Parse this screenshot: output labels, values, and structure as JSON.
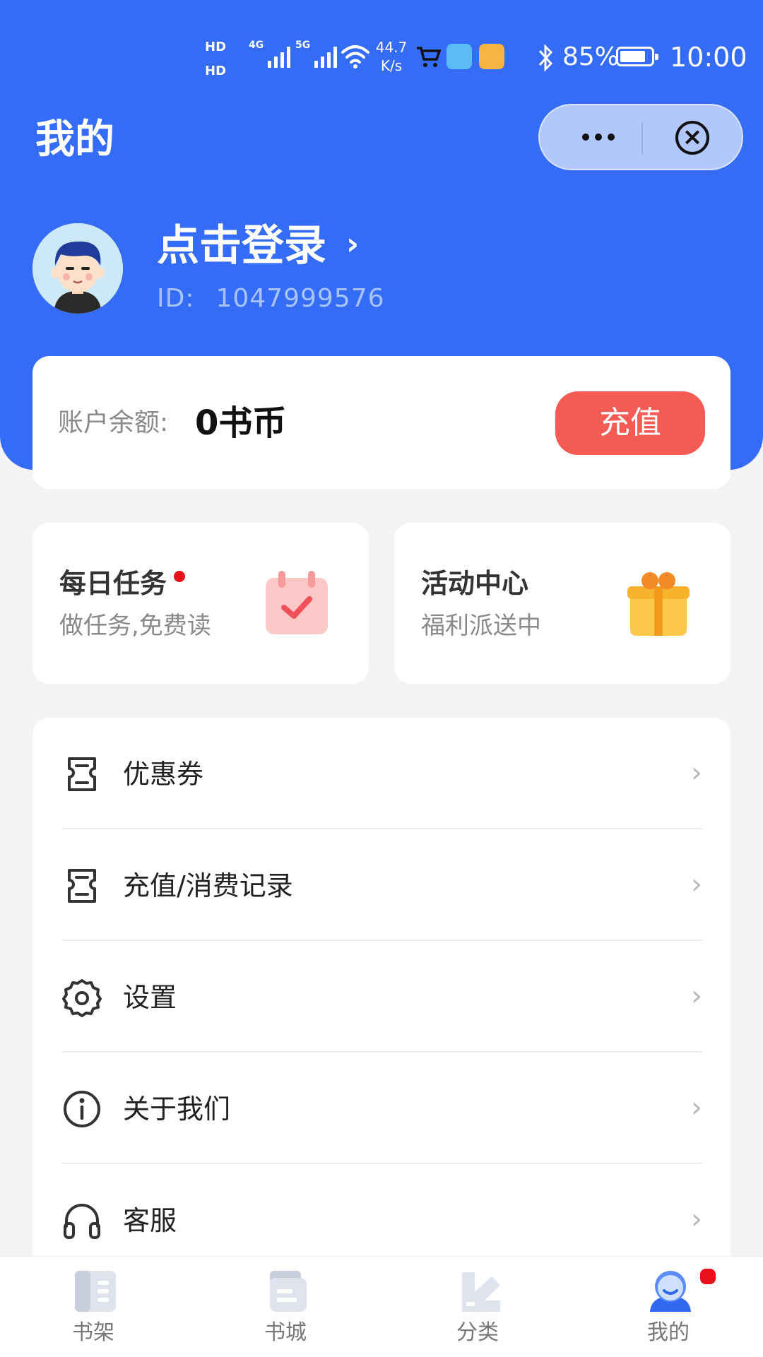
{
  "status_bar": {
    "hd_label": "HD",
    "net1": "4G",
    "net2": "5G",
    "speed_value": "44.7",
    "speed_unit": "K/s",
    "battery": "85%",
    "battery_level": 0.85,
    "time": "10:00"
  },
  "header": {
    "title": "我的",
    "bg_color": "#356cf5"
  },
  "profile": {
    "login_text": "点击登录",
    "id_label": "ID:",
    "id_value": "1047999576"
  },
  "balance": {
    "label": "账户余额:",
    "value": "0书币",
    "recharge_label": "充值",
    "recharge_color": "#f45b55"
  },
  "cards": [
    {
      "title": "每日任务",
      "subtitle": "做任务,免费读",
      "icon": "calendar-check-icon",
      "has_dot": true
    },
    {
      "title": "活动中心",
      "subtitle": "福利派送中",
      "icon": "gift-icon",
      "has_dot": false
    }
  ],
  "menu": [
    {
      "label": "优惠券",
      "icon": "coupon-icon"
    },
    {
      "label": "充值/消费记录",
      "icon": "ticket-record-icon"
    },
    {
      "label": "设置",
      "icon": "gear-icon"
    },
    {
      "label": "关于我们",
      "icon": "info-icon"
    },
    {
      "label": "客服",
      "icon": "headset-icon"
    }
  ],
  "tabs": [
    {
      "label": "书架",
      "icon": "bookshelf-icon"
    },
    {
      "label": "书城",
      "icon": "bookstore-icon"
    },
    {
      "label": "分类",
      "icon": "category-icon"
    },
    {
      "label": "我的",
      "icon": "profile-icon",
      "active": true,
      "has_dot": true
    }
  ]
}
